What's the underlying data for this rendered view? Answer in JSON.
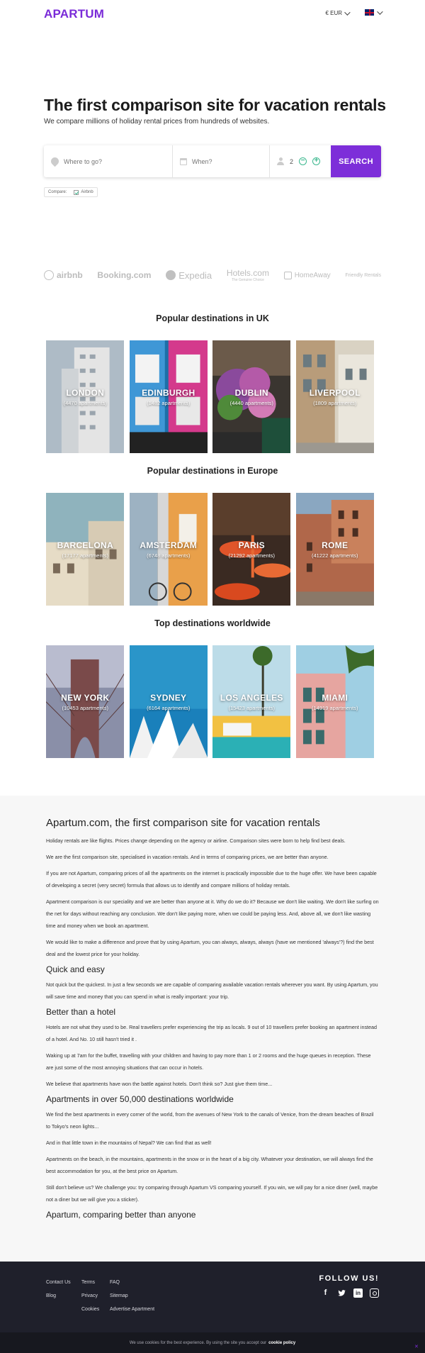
{
  "header": {
    "logo": "APARTUM",
    "currency": "€ EUR",
    "language": "EN"
  },
  "hero": {
    "title": "The first comparison site for vacation rentals",
    "subtitle": "We compare millions of holiday rental prices from hundreds of websites."
  },
  "search": {
    "where_placeholder": "Where to go?",
    "when_placeholder": "When?",
    "guests": "2",
    "button": "SEARCH",
    "compare_label": "Compare:",
    "compare_option": "Airbnb"
  },
  "partners": [
    "airbnb",
    "Booking.com",
    "Expedia",
    "Hotels.com",
    "The Genuine Choice",
    "HomeAway",
    "Friendly Rentals"
  ],
  "sections": [
    {
      "title": "Popular destinations in UK",
      "cards": [
        {
          "city": "LONDON",
          "count": "(4470 apartments)"
        },
        {
          "city": "EDINBURGH",
          "count": "(1482 apartments)"
        },
        {
          "city": "DUBLIN",
          "count": "(4440 apartments)"
        },
        {
          "city": "LIVERPOOL",
          "count": "(1809 apartments)"
        }
      ]
    },
    {
      "title": "Popular destinations in Europe",
      "cards": [
        {
          "city": "BARCELONA",
          "count": "(17177 apartments)"
        },
        {
          "city": "AMSTERDAM",
          "count": "(6748 apartments)"
        },
        {
          "city": "PARIS",
          "count": "(21292 apartments)"
        },
        {
          "city": "ROME",
          "count": "(41222 apartments)"
        }
      ]
    },
    {
      "title": "Top destinations worldwide",
      "cards": [
        {
          "city": "NEW YORK",
          "count": "(10453 apartments)"
        },
        {
          "city": "SYDNEY",
          "count": "(6164 apartments)"
        },
        {
          "city": "LOS ANGELES",
          "count": "(15423 apartments)"
        },
        {
          "city": "MIAMI",
          "count": "(14919 apartments)"
        }
      ]
    }
  ],
  "info": {
    "title": "Apartum.com, the first comparison site for vacation rentals",
    "p1": "Holiday rentals are like flights. Prices change depending on the agency or airline. Comparison sites were born to help find best deals.",
    "p2": "We are the first comparison site, specialised in vacation rentals. And in terms of comparing prices, we are better than anyone.",
    "p3": "If you are not Apartum, comparing prices of all the apartments on the internet is practically impossible due to the huge offer. We have been capable of developing a secret (very secret) formula that allows us to identify and compare millions of holiday rentals.",
    "p4": "Apartment comparison is our speciality and we are better than anyone at it. Why do we do it? Because we don't like waiting. We don't like surfing on the net for days without reaching any conclusion. We don't like paying more, when we could be paying less. And, above all, we don't like wasting time and money when we book an apartment.",
    "p5": "We would like to make a difference and prove that by using Apartum, you can always, always, always (have we mentioned 'always'?) find the best deal and the lowest price for your holiday.",
    "h_quick": "Quick and easy",
    "p6": "Not quick but the quickest. In just a few seconds we are capable of comparing available vacation rentals wherever you want. By using Apartum, you will save time and money that you can spend in what is really important: your trip.",
    "h_hotel": "Better than a hotel",
    "p7": "Hotels are not what they used to be. Real travellers prefer experiencing the trip as locals. 9 out of 10 travellers prefer booking an apartment instead of a hotel. And No. 10 still hasn't tried it .",
    "p8": "Waking up at 7am for the buffet, travelling with your children and having to pay more than 1 or 2 rooms and the huge queues in reception. These are just some of the most annoying situations that can occur in hotels.",
    "p9": "We believe that apartments have won the battle against hotels. Don't think so? Just give them time...",
    "h_dest": "Apartments in over 50,000 destinations worldwide",
    "p10": "We find the best apartments in every corner of the world, from the avenues of New York to the canals of Venice, from the dream beaches of Brazil to Tokyo's neon lights...",
    "p11": "And in that little town in the mountains of Nepal? We can find that as well!",
    "p12": "Apartments on the beach, in the mountains, apartments in the snow or in the heart of a big city. Whatever your destination, we will always find the best accommodation for you, at the best price on Apartum.",
    "p13": "Still don't believe us? We challenge you: try comparing through Apartum VS comparing yourself. If you win, we will pay for a nice diner (well, maybe not a diner but we will give you a sticker).",
    "h_final": "Apartum, comparing better than anyone"
  },
  "footer": {
    "col1": [
      "Contact Us",
      "Blog"
    ],
    "col2": [
      "Terms",
      "Privacy",
      "Cookies"
    ],
    "col3": [
      "FAQ",
      "Sitemap",
      "Advertise Apartment"
    ],
    "follow": "FOLLOW US!"
  },
  "cookie": {
    "text": "We use cookies for the best experience. By using the site you accept our",
    "link": "cookie policy"
  },
  "colors": {
    "brand": "#7d2ed9",
    "accent_green": "#3cb88f",
    "footer_bg": "#1f202b"
  }
}
